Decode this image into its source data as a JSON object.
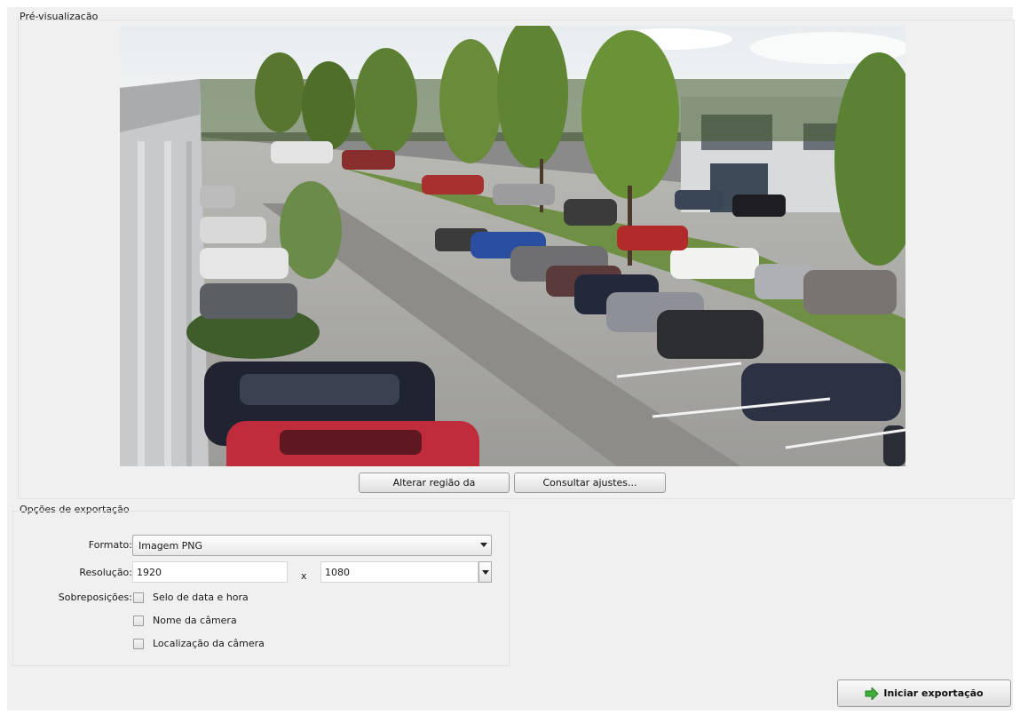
{
  "preview": {
    "title": "Pré-visualização",
    "change_region_label": "Alterar região da",
    "view_settings_label": "Consultar ajustes..."
  },
  "export_options": {
    "title": "Opções de exportação",
    "format_label": "Formato:",
    "format_value": "Imagem PNG",
    "resolution_label": "Resolução:",
    "width_value": "1920",
    "separator": "x",
    "height_value": "1080",
    "overlays_label": "Sobreposições:",
    "overlays": [
      {
        "label": "Selo de data e hora",
        "checked": false
      },
      {
        "label": "Nome da câmera",
        "checked": false
      },
      {
        "label": "Localização da câmera",
        "checked": false
      }
    ]
  },
  "actions": {
    "start_export_label": "Iniciar exportação",
    "start_export_icon": "green-arrow-icon"
  },
  "colors": {
    "panel_bg": "#f0f0f0",
    "accent_green": "#3fae3a"
  }
}
